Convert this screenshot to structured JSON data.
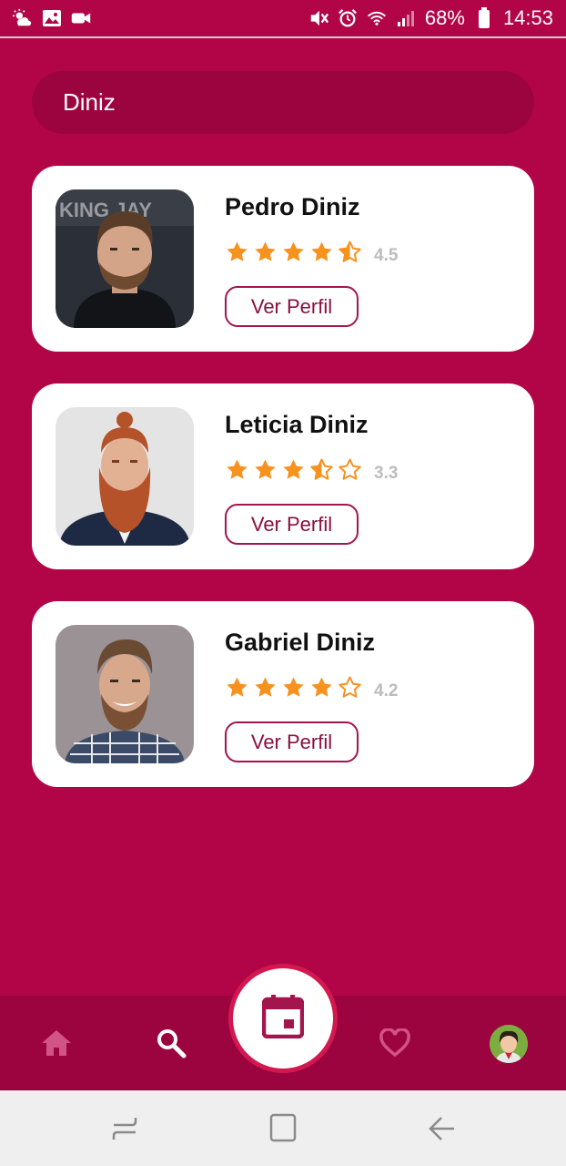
{
  "status_bar": {
    "battery": "68%",
    "time": "14:53",
    "icons": [
      "weather-icon",
      "image-icon",
      "video-icon",
      "mute-icon",
      "alarm-icon",
      "wifi-icon",
      "signal-icon",
      "battery-icon"
    ]
  },
  "search": {
    "value": "Diniz",
    "placeholder": ""
  },
  "results": [
    {
      "name": "Pedro Diniz",
      "rating": 4.5,
      "rating_text": "4.5",
      "button_label": "Ver Perfil"
    },
    {
      "name": "Leticia Diniz",
      "rating": 3.3,
      "rating_text": "3.3",
      "button_label": "Ver Perfil"
    },
    {
      "name": "Gabriel Diniz",
      "rating": 4.2,
      "rating_text": "4.2",
      "button_label": "Ver Perfil"
    }
  ],
  "bottom_nav": {
    "items": [
      "home-icon",
      "search-icon",
      "calendar-icon",
      "heart-icon",
      "profile-avatar"
    ],
    "active": "search-icon"
  },
  "colors": {
    "background": "#b10548",
    "search_bg": "#9c0440",
    "star": "#f7921e",
    "accent_border": "#a3154d"
  }
}
